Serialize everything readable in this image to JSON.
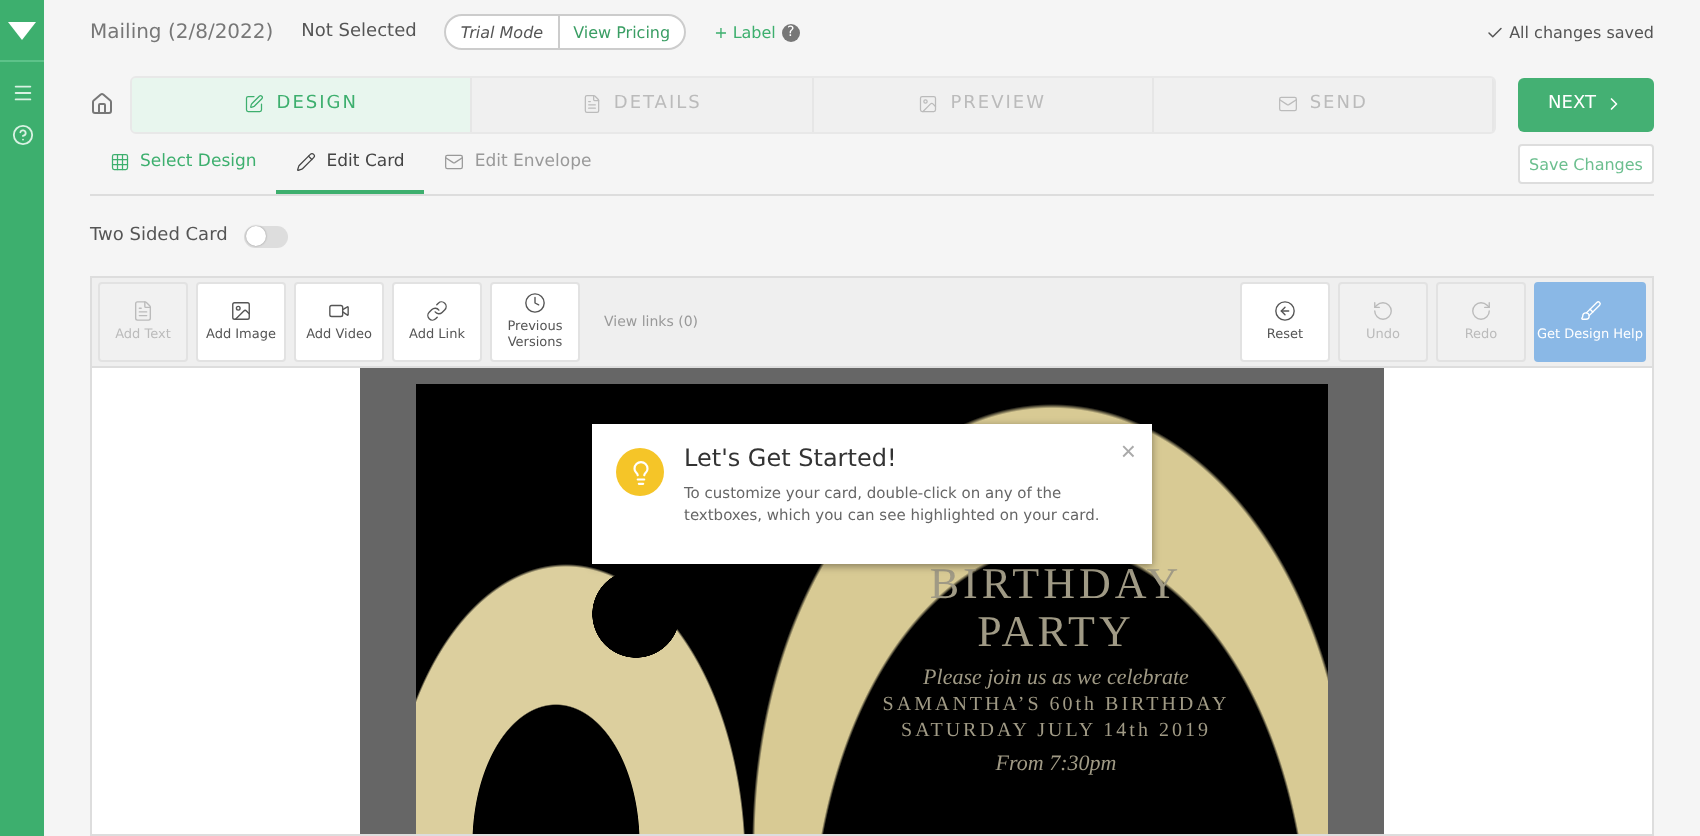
{
  "header": {
    "title": "Mailing (2/8/2022)",
    "status": "Not Selected",
    "trial": "Trial Mode",
    "pricing": "View Pricing",
    "label": "+ Label",
    "help": "?",
    "saved": "All changes saved"
  },
  "steps": [
    {
      "label": "DESIGN",
      "selected": true
    },
    {
      "label": "DETAILS",
      "selected": false
    },
    {
      "label": "PREVIEW",
      "selected": false
    },
    {
      "label": "SEND",
      "selected": false
    }
  ],
  "next": "NEXT",
  "subtabs": [
    {
      "label": "Select Design",
      "selected": false,
      "disabled": false
    },
    {
      "label": "Edit Card",
      "selected": true,
      "disabled": false
    },
    {
      "label": "Edit Envelope",
      "selected": false,
      "disabled": true
    }
  ],
  "save": "Save Changes",
  "two_sided": {
    "label": "Two Sided Card",
    "on": false
  },
  "tools_left": [
    {
      "label": "Add Text",
      "disabled": true
    },
    {
      "label": "Add Image",
      "disabled": false
    },
    {
      "label": "Add Video",
      "disabled": false
    },
    {
      "label": "Add Link",
      "disabled": false
    },
    {
      "label": "Previous Versions",
      "disabled": false
    }
  ],
  "view_links": "View links (0)",
  "tools_right": [
    {
      "label": "Reset",
      "disabled": false,
      "kind": "plain"
    },
    {
      "label": "Undo",
      "disabled": true,
      "kind": "plain"
    },
    {
      "label": "Redo",
      "disabled": true,
      "kind": "plain"
    },
    {
      "label": "Get Design Help",
      "disabled": false,
      "kind": "accent"
    }
  ],
  "card": {
    "lines": [
      {
        "text": "BIRTHDAY",
        "kind": "title"
      },
      {
        "text": "PARTY",
        "kind": "title"
      },
      {
        "text": "Please join us as we celebrate",
        "kind": "script"
      },
      {
        "text": "SAMANTHA’S 60th BIRTHDAY",
        "kind": "caps"
      },
      {
        "text": "SATURDAY JULY 14th 2019",
        "kind": "caps"
      },
      {
        "text": "From 7:30pm",
        "kind": "script"
      }
    ]
  },
  "popup": {
    "title": "Let's Get Started!",
    "body": "To customize your card, double-click on any of the textboxes, which you can see highlighted on your card.",
    "close": "×"
  }
}
